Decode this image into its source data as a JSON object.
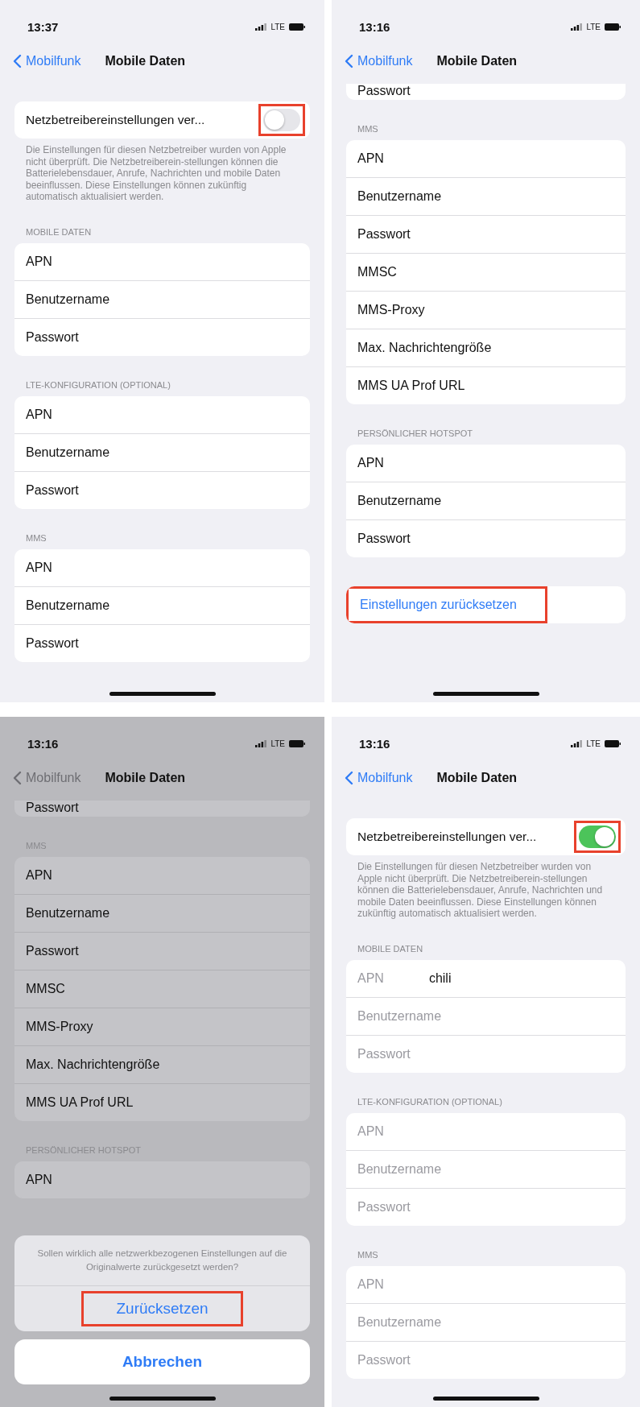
{
  "panels": [
    {
      "dimmed": false,
      "time": "13:37",
      "network": "LTE",
      "back": "Mobilfunk",
      "title": "Mobile Daten",
      "sections": [
        {
          "kind": "toggle",
          "label": "Netzbetreibereinstellungen ver...",
          "on": false,
          "annotated": true,
          "footer": "Die Einstellungen für diesen Netzbetreiber wurden von Apple nicht überprüft. Die Netzbetreiberein-stellungen können die Batterielebensdauer, Anrufe, Nachrichten und mobile Daten beeinflussen. Diese Einstellungen können zukünftig automatisch aktualisiert werden."
        },
        {
          "kind": "group",
          "header": "MOBILE DATEN",
          "rows": [
            {
              "label": "APN",
              "disabled": false
            },
            {
              "label": "Benutzername",
              "disabled": false
            },
            {
              "label": "Passwort",
              "disabled": false
            }
          ]
        },
        {
          "kind": "group",
          "header": "LTE-KONFIGURATION (OPTIONAL)",
          "rows": [
            {
              "label": "APN",
              "disabled": false
            },
            {
              "label": "Benutzername",
              "disabled": false
            },
            {
              "label": "Passwort",
              "disabled": false
            }
          ]
        },
        {
          "kind": "group",
          "header": "MMS",
          "rows": [
            {
              "label": "APN",
              "disabled": false
            },
            {
              "label": "Benutzername",
              "disabled": false
            },
            {
              "label": "Passwort",
              "disabled": false
            }
          ]
        }
      ]
    },
    {
      "dimmed": false,
      "time": "13:16",
      "network": "LTE",
      "back": "Mobilfunk",
      "title": "Mobile Daten",
      "sections": [
        {
          "kind": "cut",
          "rows": [
            {
              "label": "Passwort",
              "disabled": false
            }
          ]
        },
        {
          "kind": "group",
          "header": "MMS",
          "rows": [
            {
              "label": "APN",
              "disabled": false
            },
            {
              "label": "Benutzername",
              "disabled": false
            },
            {
              "label": "Passwort",
              "disabled": false
            },
            {
              "label": "MMSC",
              "disabled": false
            },
            {
              "label": "MMS-Proxy",
              "disabled": false
            },
            {
              "label": "Max. Nachrichtengröße",
              "disabled": false
            },
            {
              "label": "MMS UA Prof URL",
              "disabled": false
            }
          ]
        },
        {
          "kind": "group",
          "header": "PERSÖNLICHER HOTSPOT",
          "rows": [
            {
              "label": "APN",
              "disabled": false
            },
            {
              "label": "Benutzername",
              "disabled": false
            },
            {
              "label": "Passwort",
              "disabled": false
            }
          ]
        },
        {
          "kind": "link",
          "label": "Einstellungen zurücksetzen",
          "highlighted": true
        }
      ]
    },
    {
      "dimmed": true,
      "time": "13:16",
      "network": "LTE",
      "back": "Mobilfunk",
      "title": "Mobile Daten",
      "sections": [
        {
          "kind": "cut",
          "rows": [
            {
              "label": "Passwort",
              "disabled": false
            }
          ]
        },
        {
          "kind": "group",
          "header": "MMS",
          "rows": [
            {
              "label": "APN",
              "disabled": false
            },
            {
              "label": "Benutzername",
              "disabled": false
            },
            {
              "label": "Passwort",
              "disabled": false
            },
            {
              "label": "MMSC",
              "disabled": false
            },
            {
              "label": "MMS-Proxy",
              "disabled": false
            },
            {
              "label": "Max. Nachrichtengröße",
              "disabled": false
            },
            {
              "label": "MMS UA Prof URL",
              "disabled": false
            }
          ]
        },
        {
          "kind": "group",
          "header": "PERSÖNLICHER HOTSPOT",
          "rows": [
            {
              "label": "APN",
              "disabled": false
            }
          ]
        }
      ],
      "sheet": {
        "message": "Sollen wirklich alle netzwerkbezogenen Einstellungen auf die Originalwerte zurückgesetzt werden?",
        "action": "Zurücksetzen",
        "action_highlighted": true,
        "cancel": "Abbrechen"
      }
    },
    {
      "dimmed": false,
      "time": "13:16",
      "network": "LTE",
      "back": "Mobilfunk",
      "title": "Mobile Daten",
      "sections": [
        {
          "kind": "toggle",
          "label": "Netzbetreibereinstellungen ver...",
          "on": true,
          "annotated": true,
          "footer": "Die Einstellungen für diesen Netzbetreiber wurden von Apple nicht überprüft. Die Netzbetreiberein-stellungen können die Batterielebensdauer, Anrufe, Nachrichten und mobile Daten beeinflussen. Diese Einstellungen können zukünftig automatisch aktualisiert werden."
        },
        {
          "kind": "group",
          "header": "MOBILE DATEN",
          "rows": [
            {
              "label": "APN",
              "value": "chili",
              "disabled": true
            },
            {
              "label": "Benutzername",
              "disabled": true
            },
            {
              "label": "Passwort",
              "disabled": true
            }
          ]
        },
        {
          "kind": "group",
          "header": "LTE-KONFIGURATION (OPTIONAL)",
          "rows": [
            {
              "label": "APN",
              "disabled": true
            },
            {
              "label": "Benutzername",
              "disabled": true
            },
            {
              "label": "Passwort",
              "disabled": true
            }
          ]
        },
        {
          "kind": "group",
          "header": "MMS",
          "rows": [
            {
              "label": "APN",
              "disabled": true
            },
            {
              "label": "Benutzername",
              "disabled": true
            },
            {
              "label": "Passwort",
              "disabled": true
            }
          ]
        }
      ]
    }
  ]
}
